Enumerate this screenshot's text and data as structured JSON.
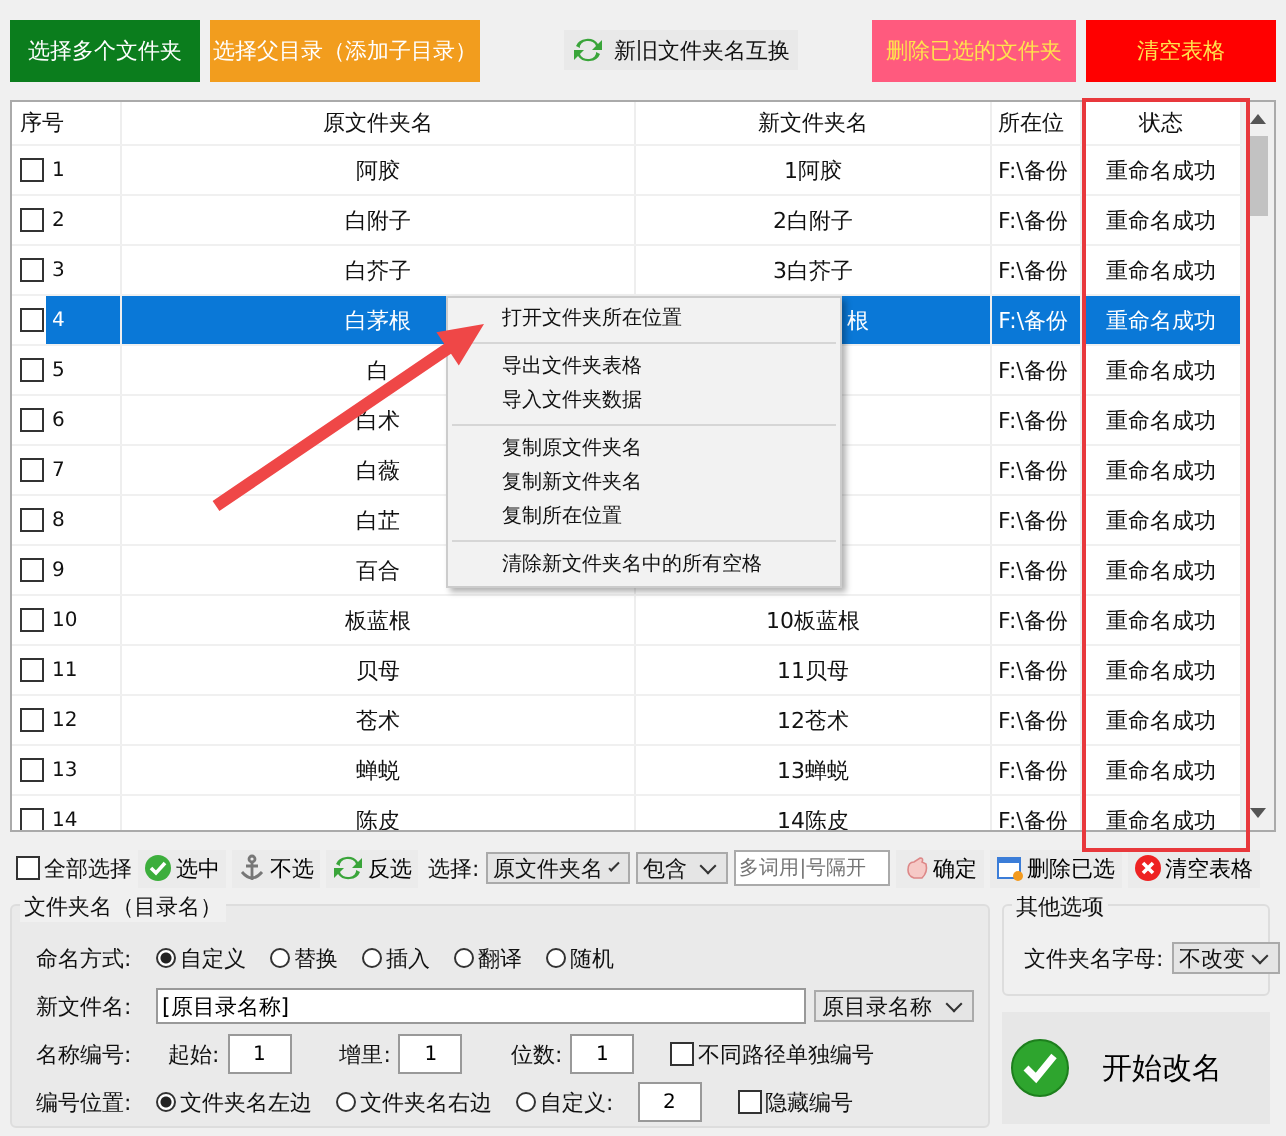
{
  "top_buttons": [
    {
      "label": "选择多个文件夹",
      "kind": "solid",
      "color": "#0b7d1d"
    },
    {
      "label": "选择父目录（添加子目录）",
      "kind": "solid",
      "color": "#f29d1e"
    },
    {
      "label": "新旧文件夹名互换",
      "kind": "swap"
    },
    {
      "label": "删除已选的文件夹",
      "kind": "solid",
      "color": "#ff5a7e"
    },
    {
      "label": "清空表格",
      "kind": "solid",
      "color": "#ff0000"
    }
  ],
  "table": {
    "columns": [
      "序号",
      "原文件夹名",
      "新文件夹名",
      "所在位",
      "状态"
    ],
    "rows": [
      {
        "index": "1",
        "checked": false,
        "selected": false,
        "original": "阿胶",
        "new_name": "1阿胶",
        "location": "F:\\备份",
        "status": "重命名成功"
      },
      {
        "index": "2",
        "checked": false,
        "selected": false,
        "original": "白附子",
        "new_name": "2白附子",
        "location": "F:\\备份",
        "status": "重命名成功"
      },
      {
        "index": "3",
        "checked": false,
        "selected": false,
        "original": "白芥子",
        "new_name": "3白芥子",
        "location": "F:\\备份",
        "status": "重命名成功"
      },
      {
        "index": "4",
        "checked": false,
        "selected": true,
        "original": "白茅根",
        "new_name": "根",
        "location": "F:\\备份",
        "status": "重命名成功",
        "covered": true
      },
      {
        "index": "5",
        "checked": false,
        "selected": false,
        "original": "白",
        "location": "F:\\备份",
        "status": "重命名成功"
      },
      {
        "index": "6",
        "checked": false,
        "selected": false,
        "original": "白术",
        "location": "F:\\备份",
        "status": "重命名成功"
      },
      {
        "index": "7",
        "checked": false,
        "selected": false,
        "original": "白薇",
        "location": "F:\\备份",
        "status": "重命名成功"
      },
      {
        "index": "8",
        "checked": false,
        "selected": false,
        "original": "白芷",
        "location": "F:\\备份",
        "status": "重命名成功"
      },
      {
        "index": "9",
        "checked": false,
        "selected": false,
        "original": "百合",
        "location": "F:\\备份",
        "status": "重命名成功"
      },
      {
        "index": "10",
        "checked": false,
        "selected": false,
        "original": "板蓝根",
        "new_name": "10板蓝根",
        "location": "F:\\备份",
        "status": "重命名成功"
      },
      {
        "index": "11",
        "checked": false,
        "selected": false,
        "original": "贝母",
        "new_name": "11贝母",
        "location": "F:\\备份",
        "status": "重命名成功"
      },
      {
        "index": "12",
        "checked": false,
        "selected": false,
        "original": "苍术",
        "new_name": "12苍术",
        "location": "F:\\备份",
        "status": "重命名成功"
      },
      {
        "index": "13",
        "checked": false,
        "selected": false,
        "original": "蝉蜕",
        "new_name": "13蝉蜕",
        "location": "F:\\备份",
        "status": "重命名成功"
      },
      {
        "index": "14",
        "checked": false,
        "selected": false,
        "original": "陈皮",
        "new_name": "14陈皮",
        "location": "F:\\备份",
        "status": "重命名成功"
      }
    ]
  },
  "context_menu": {
    "groups": [
      [
        "打开文件夹所在位置"
      ],
      [
        "导出文件夹表格",
        "导入文件夹数据"
      ],
      [
        "复制原文件夹名",
        "复制新文件夹名",
        "复制所在位置"
      ],
      [
        "清除新文件夹名中的所有空格"
      ]
    ]
  },
  "toolbar": {
    "select_all": {
      "label": "全部选择",
      "checked": false
    },
    "buttons": [
      {
        "label": "选中",
        "kind": "check"
      },
      {
        "label": "不选",
        "kind": "anchor"
      },
      {
        "label": "反选",
        "kind": "swap"
      }
    ],
    "select_label": "选择:",
    "dropdowns": [
      "原文件夹名",
      "包含"
    ],
    "filter_placeholder": "多词用|号隔开",
    "actions": [
      {
        "label": "确定",
        "kind": "hand"
      },
      {
        "label": "删除已选",
        "kind": "window"
      },
      {
        "label": "清空表格",
        "kind": "close"
      }
    ]
  },
  "rename": {
    "title": "文件夹名（目录名）",
    "mode_label": "命名方式:",
    "modes": [
      {
        "label": "自定义",
        "selected": true
      },
      {
        "label": "替换",
        "selected": false
      },
      {
        "label": "插入",
        "selected": false
      },
      {
        "label": "翻译",
        "selected": false
      },
      {
        "label": "随机",
        "selected": false
      }
    ],
    "new_name_label": "新文件名:",
    "new_name_value": "[原目录名称]",
    "new_name_dropdown": "原目录名称",
    "number_label": "名称编号:",
    "number_fields": [
      {
        "label": "起始:",
        "value": "1"
      },
      {
        "label": "增里:",
        "value": "1"
      },
      {
        "label": "位数:",
        "value": "1"
      }
    ],
    "separate_numbering": {
      "label": "不同路径单独编号",
      "checked": false
    },
    "position_label": "编号位置:",
    "positions": [
      {
        "label": "文件夹名左边",
        "selected": true
      },
      {
        "label": "文件夹名右边",
        "selected": false
      },
      {
        "label": "自定义:",
        "selected": false
      }
    ],
    "custom_value": "2",
    "hide_number": {
      "label": "隐藏编号",
      "checked": false
    }
  },
  "other": {
    "title": "其他选项",
    "letter_label": "文件夹名字母:",
    "letter_value": "不改变"
  },
  "start_button": {
    "label": "开始改名"
  }
}
